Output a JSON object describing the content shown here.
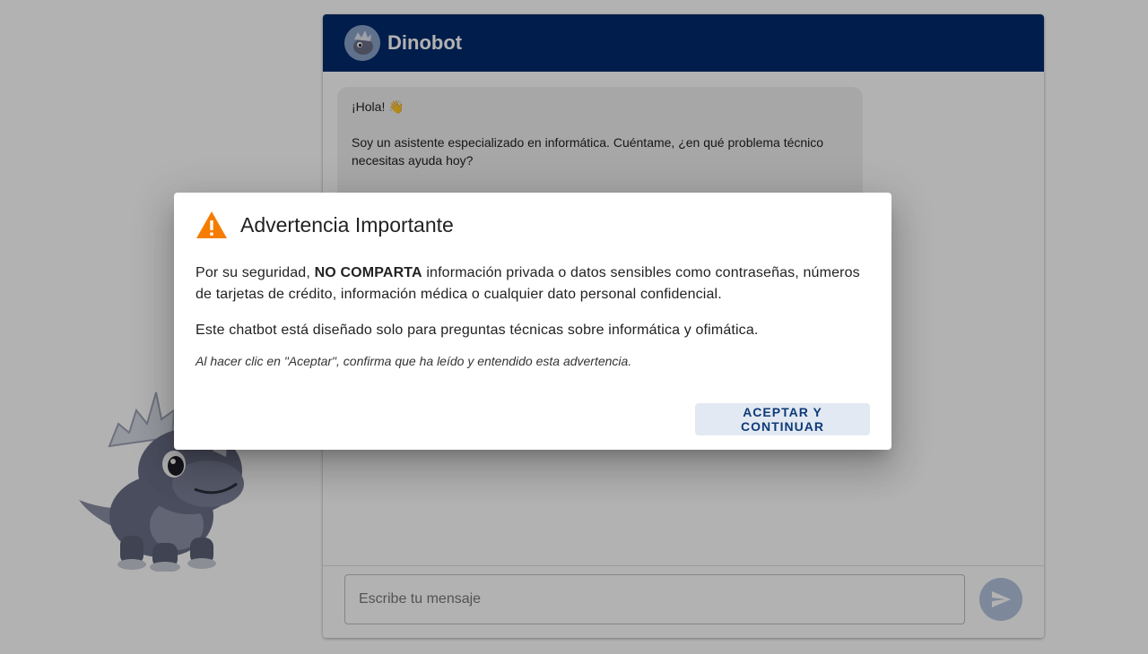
{
  "header": {
    "title": "Dinobot",
    "avatar_icon": "dino-avatar-icon"
  },
  "chat": {
    "bot_message": {
      "greeting": "¡Hola! 👋",
      "intro": "Soy un asistente especializado en informática. Cuéntame, ¿en qué problema técnico necesitas ayuda hoy?"
    }
  },
  "composer": {
    "placeholder": "Escribe tu mensaje",
    "send_icon": "send-icon"
  },
  "dialog": {
    "title": "Advertencia Importante",
    "warning_icon": "warning-icon",
    "paragraph1_before": "Por su seguridad, ",
    "paragraph1_bold": "NO COMPARTA",
    "paragraph1_after": " información privada o datos sensibles como contraseñas, números de tarjetas de crédito, información médica o cualquier dato personal confidencial.",
    "paragraph2": "Este chatbot está diseñado solo para preguntas técnicas sobre informática y ofimática.",
    "note": "Al hacer clic en \"Aceptar\", confirma que ha leído y entendido esta advertencia.",
    "accept_label": "ACEPTAR Y CONTINUAR"
  },
  "colors": {
    "header_bg": "#002a6c",
    "warning": "#f57c00",
    "send_button": "#b3c4dd",
    "accept_text": "#0d3a78"
  }
}
